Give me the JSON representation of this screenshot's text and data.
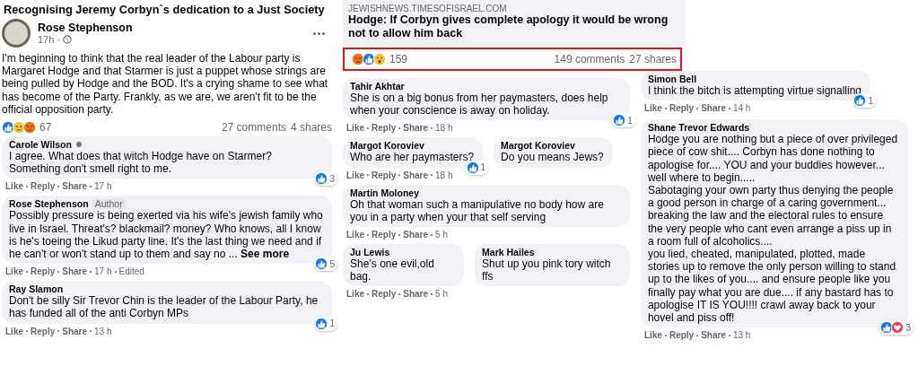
{
  "post": {
    "group_title": "Recognising Jeremy Corbyn`s dedication to a Just Society",
    "author": "Rose Stephenson",
    "time": "17h ·",
    "text": "I'm beginning to think that the real leader of the Labour party is Margaret Hodge and that Starmer is just a puppet whose strings are being pulled by Hodge and the BOD. It's a crying shame to see what has become of the Party. Frankly, as we are, we aren't fit to be the official opposition party.",
    "reactions": [
      {
        "kind": "like"
      },
      {
        "kind": "sad"
      },
      {
        "kind": "angry"
      }
    ],
    "reaction_count": "67",
    "comments_count": "27 comments",
    "shares_count": "4 shares",
    "comments": [
      {
        "author": "Carole Wilson",
        "badge_icon": true,
        "text": "I agree. What does that witch Hodge have on Starmer? Something don't smell right to me.",
        "actions": [
          "Like",
          "Reply",
          "Share"
        ],
        "time": "17 h",
        "reactions": [
          {
            "kind": "like"
          }
        ],
        "reaction_count": "3"
      },
      {
        "author": "Rose Stephenson",
        "badge_icon": false,
        "author_label": "Author",
        "text": "Possibly pressure is being exerted via his wife's jewish family who live in Israel. Threat's? blackmail? money? Who knows, all I know is he's toeing the Likud party line. It's the last thing we need and if he can't or won't stand up to them and say no ...",
        "see_more": "See more",
        "actions": [
          "Like",
          "Reply",
          "Share"
        ],
        "time": "17 h",
        "edited": "Edited",
        "reactions": [
          {
            "kind": "like"
          }
        ],
        "reaction_count": "5"
      },
      {
        "author": "Ray Slamon",
        "badge_icon": false,
        "text": "Don't be silly Sir Trevor Chin is the leader of the Labour Party, he has funded all of the anti Corbyn MPs",
        "actions": [
          "Like",
          "Reply",
          "Share"
        ],
        "time": "13 h",
        "reactions": [
          {
            "kind": "like"
          }
        ],
        "reaction_count": "1"
      }
    ]
  },
  "article": {
    "domain": "JEWISHNEWS.TIMESOFISRAEL.COM",
    "headline": "Hodge: If Corbyn gives complete apology it would be wrong not to allow him back",
    "reactions": [
      {
        "kind": "angry"
      },
      {
        "kind": "like"
      },
      {
        "kind": "wow"
      }
    ],
    "reaction_count": "159",
    "comments_count": "149 comments",
    "shares_count": "27 shares",
    "highlighted": true,
    "rows": [
      {
        "comments": [
          {
            "author": "Tahir Akhtar",
            "text": "She is on a big bonus from her paymasters, does help when your conscience is away on holiday.",
            "actions": [
              "Like",
              "Reply",
              "Share"
            ],
            "time": "18 h",
            "reactions": [
              {
                "kind": "like"
              }
            ],
            "reaction_count": "1"
          }
        ]
      },
      {
        "comments": [
          {
            "author": "Margot Koroviev",
            "text": "Who are her paymasters?",
            "actions": [
              "Like",
              "Reply",
              "Share"
            ],
            "time": "18 h",
            "reactions": [
              {
                "kind": "like"
              }
            ],
            "reaction_count": "1"
          },
          {
            "author": "Margot Koroviev",
            "text": "Do you means Jews?"
          }
        ]
      },
      {
        "comments": [
          {
            "author": "Martin Moloney",
            "text": "Oh that woman such a manipulative no body how are you in a party when your that self serving",
            "actions": [
              "Like",
              "Reply",
              "Share"
            ],
            "time": "5 h"
          }
        ]
      },
      {
        "comments": [
          {
            "author": "Ju Lewis",
            "text": "She’s one evil,old bag.",
            "actions": [
              "Like",
              "Reply",
              "Share"
            ],
            "time": "5 h"
          },
          {
            "author": "Mark Hailes",
            "text": "Shut up you pink tory witch ffs"
          }
        ]
      }
    ],
    "side_comments": [
      {
        "author": "Simon Bell",
        "text": "I think the bitch is attempting virtue signalling",
        "actions": [
          "Like",
          "Reply",
          "Share"
        ],
        "time": "14 h",
        "reactions": [
          {
            "kind": "like"
          }
        ],
        "reaction_count": "1"
      },
      {
        "author": "Shane Trevor Edwards",
        "text": "Hodge you are nothing but a piece of over privileged piece of cow shit.... Corbyn has done nothing to apologise for.... YOU and your buddies however... well where to begin.....\nSabotaging your own party thus denying the people a good person in charge of a caring government... breaking the law and the electoral rules to ensure the very people who cant even arrange a piss up in a room full of alcoholics....\nyou lied, cheated, manipulated, plotted, made stories up to remove the only person willing to stand up to the likes of you.... and ensure people like you finally pay what you are due.... if any bastard has to apologise IT IS YOU!!!! crawl away back to your hovel and piss off!",
        "actions": [
          "Like",
          "Reply",
          "Share"
        ],
        "time": "13 h",
        "reactions": [
          {
            "kind": "like"
          },
          {
            "kind": "love"
          }
        ],
        "reaction_count": "3"
      }
    ]
  }
}
